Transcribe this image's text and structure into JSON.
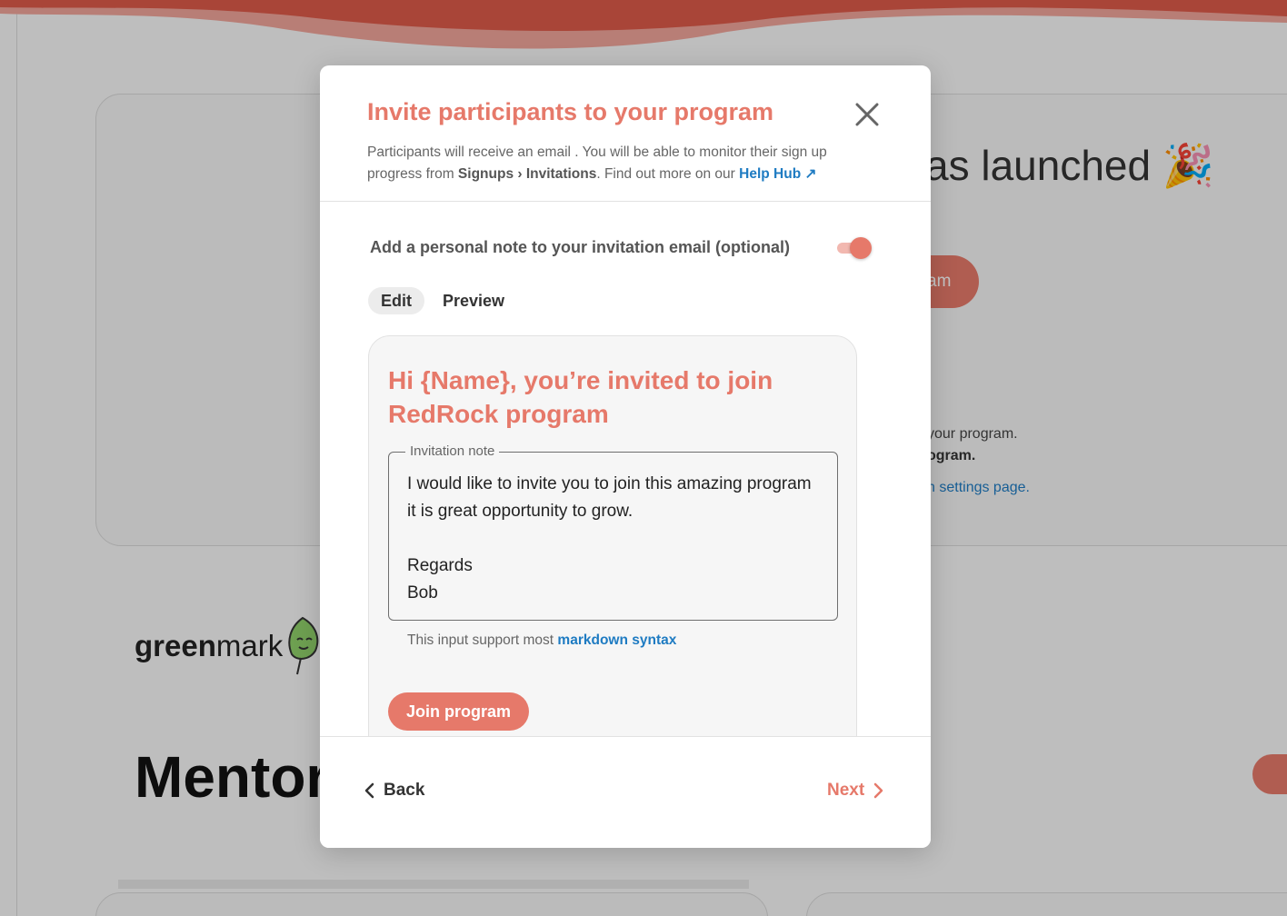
{
  "background": {
    "launched_text": "as launched",
    "pill_text": "am",
    "line1": "your program.",
    "line2": "ogram.",
    "line3": "n settings page.",
    "logo_bold": "green",
    "logo_regular": "mark",
    "mentor_title": "Mentor"
  },
  "modal": {
    "title": "Invite participants to your program",
    "desc_prefix": "Participants will receive an email . You will be able to monitor their sign up progress from ",
    "desc_path": "Signups › Invitations",
    "desc_suffix": ". Find out more on our ",
    "help_link": "Help Hub ↗",
    "toggle_label": "Add a personal note to your invitation email (optional)",
    "toggle_on": true,
    "tabs": [
      "Edit",
      "Preview"
    ],
    "active_tab": "Edit",
    "email_heading": "Hi {Name}, you’re invited to join RedRock program",
    "note_legend": "Invitation note",
    "note_value": "I would like to invite you to join this amazing program it is great opportunity to grow.\n\nRegards\nBob",
    "hint_prefix": "This input support most ",
    "hint_link": "markdown syntax",
    "join_button": "Join program",
    "back_label": "Back",
    "next_label": "Next"
  },
  "colors": {
    "accent": "#e6796a",
    "link": "#1e7bc2"
  }
}
